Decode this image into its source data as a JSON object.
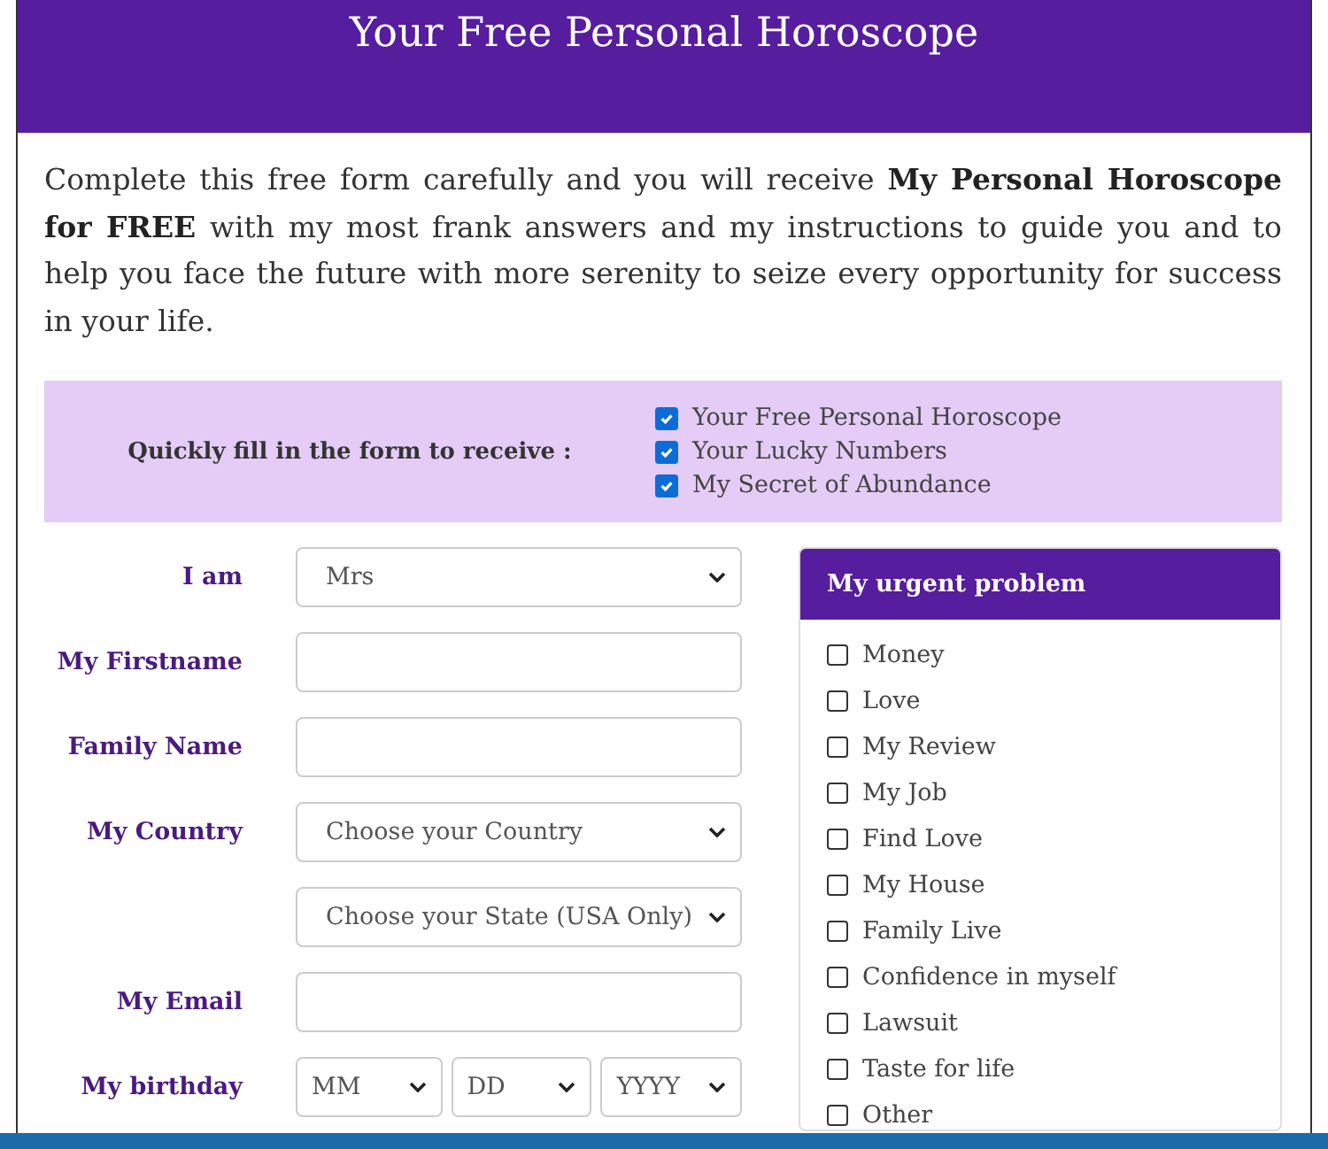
{
  "header": {
    "title": "Your Free Personal Horoscope"
  },
  "intro": "Complete this free form carefully and you will receive **My Personal Horoscope for FREE** with my most frank answers and my instructions to guide you and to help you face the future with more serenity to seize every opportunity for success in your life.",
  "offer": {
    "label": "Quickly fill in the form to receive :",
    "items": [
      {
        "label": "Your Free Personal Horoscope",
        "checked": true
      },
      {
        "label": "Your Lucky Numbers",
        "checked": true
      },
      {
        "label": "My Secret of Abundance",
        "checked": true
      }
    ]
  },
  "form": {
    "fields": [
      {
        "kind": "select",
        "label": "I am",
        "value": "Mrs"
      },
      {
        "kind": "input",
        "label": "My Firstname"
      },
      {
        "kind": "input",
        "label": "Family Name"
      },
      {
        "kind": "select",
        "label": "My Country",
        "value": "Choose your Country"
      },
      {
        "kind": "select",
        "value": "Choose your State (USA Only)"
      },
      {
        "kind": "input",
        "label": "My Email"
      },
      {
        "kind": "date",
        "label": "My birthday",
        "parts": [
          "MM",
          "DD",
          "YYYY"
        ]
      }
    ]
  },
  "problem": {
    "title": "My urgent problem",
    "options": [
      {
        "label": "Money",
        "checked": false
      },
      {
        "label": "Love",
        "checked": false
      },
      {
        "label": "My Review",
        "checked": false
      },
      {
        "label": "My Job",
        "checked": false
      },
      {
        "label": "Find Love",
        "checked": false
      },
      {
        "label": "My House",
        "checked": false
      },
      {
        "label": "Family Live",
        "checked": false
      },
      {
        "label": "Confidence in myself",
        "checked": false
      },
      {
        "label": "Lawsuit",
        "checked": false
      },
      {
        "label": "Taste for life",
        "checked": false
      },
      {
        "label": "Other",
        "checked": false
      }
    ]
  }
}
